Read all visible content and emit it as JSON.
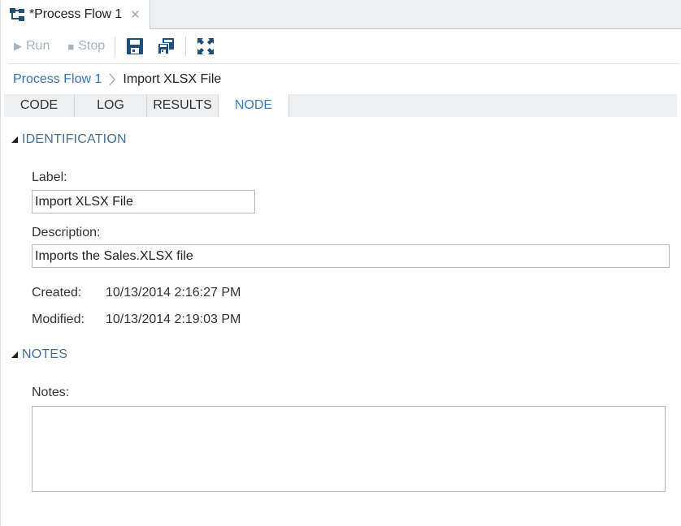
{
  "document_tab": {
    "icon": "process-flow-icon",
    "title": "*Process Flow 1",
    "close_icon": "close-icon"
  },
  "toolbar": {
    "run_label": "Run",
    "stop_label": "Stop",
    "save_icon": "save-icon",
    "save_as_icon": "save-as-icon",
    "maximize_icon": "maximize-icon"
  },
  "breadcrumb": {
    "items": [
      "Process Flow 1",
      "Import XLSX File"
    ]
  },
  "subtabs": [
    {
      "label": "CODE",
      "active": false
    },
    {
      "label": "LOG",
      "active": false
    },
    {
      "label": "RESULTS",
      "active": false
    },
    {
      "label": "NODE",
      "active": true
    }
  ],
  "identification": {
    "heading": "IDENTIFICATION",
    "label_caption": "Label:",
    "label_value": "Import XLSX File",
    "description_caption": "Description:",
    "description_value": "Imports the Sales.XLSX file",
    "created_caption": "Created:",
    "created_value": "10/13/2014 2:16:27 PM",
    "modified_caption": "Modified:",
    "modified_value": "10/13/2014 2:19:03 PM"
  },
  "notes": {
    "heading": "NOTES",
    "notes_caption": "Notes:",
    "notes_value": ""
  },
  "colors": {
    "link": "#3a72b0",
    "active_tab_text": "#3a7dc4",
    "section_heading": "#4a6d96",
    "icon_navy": "#1f4e79",
    "disabled": "#a6b4c2"
  }
}
